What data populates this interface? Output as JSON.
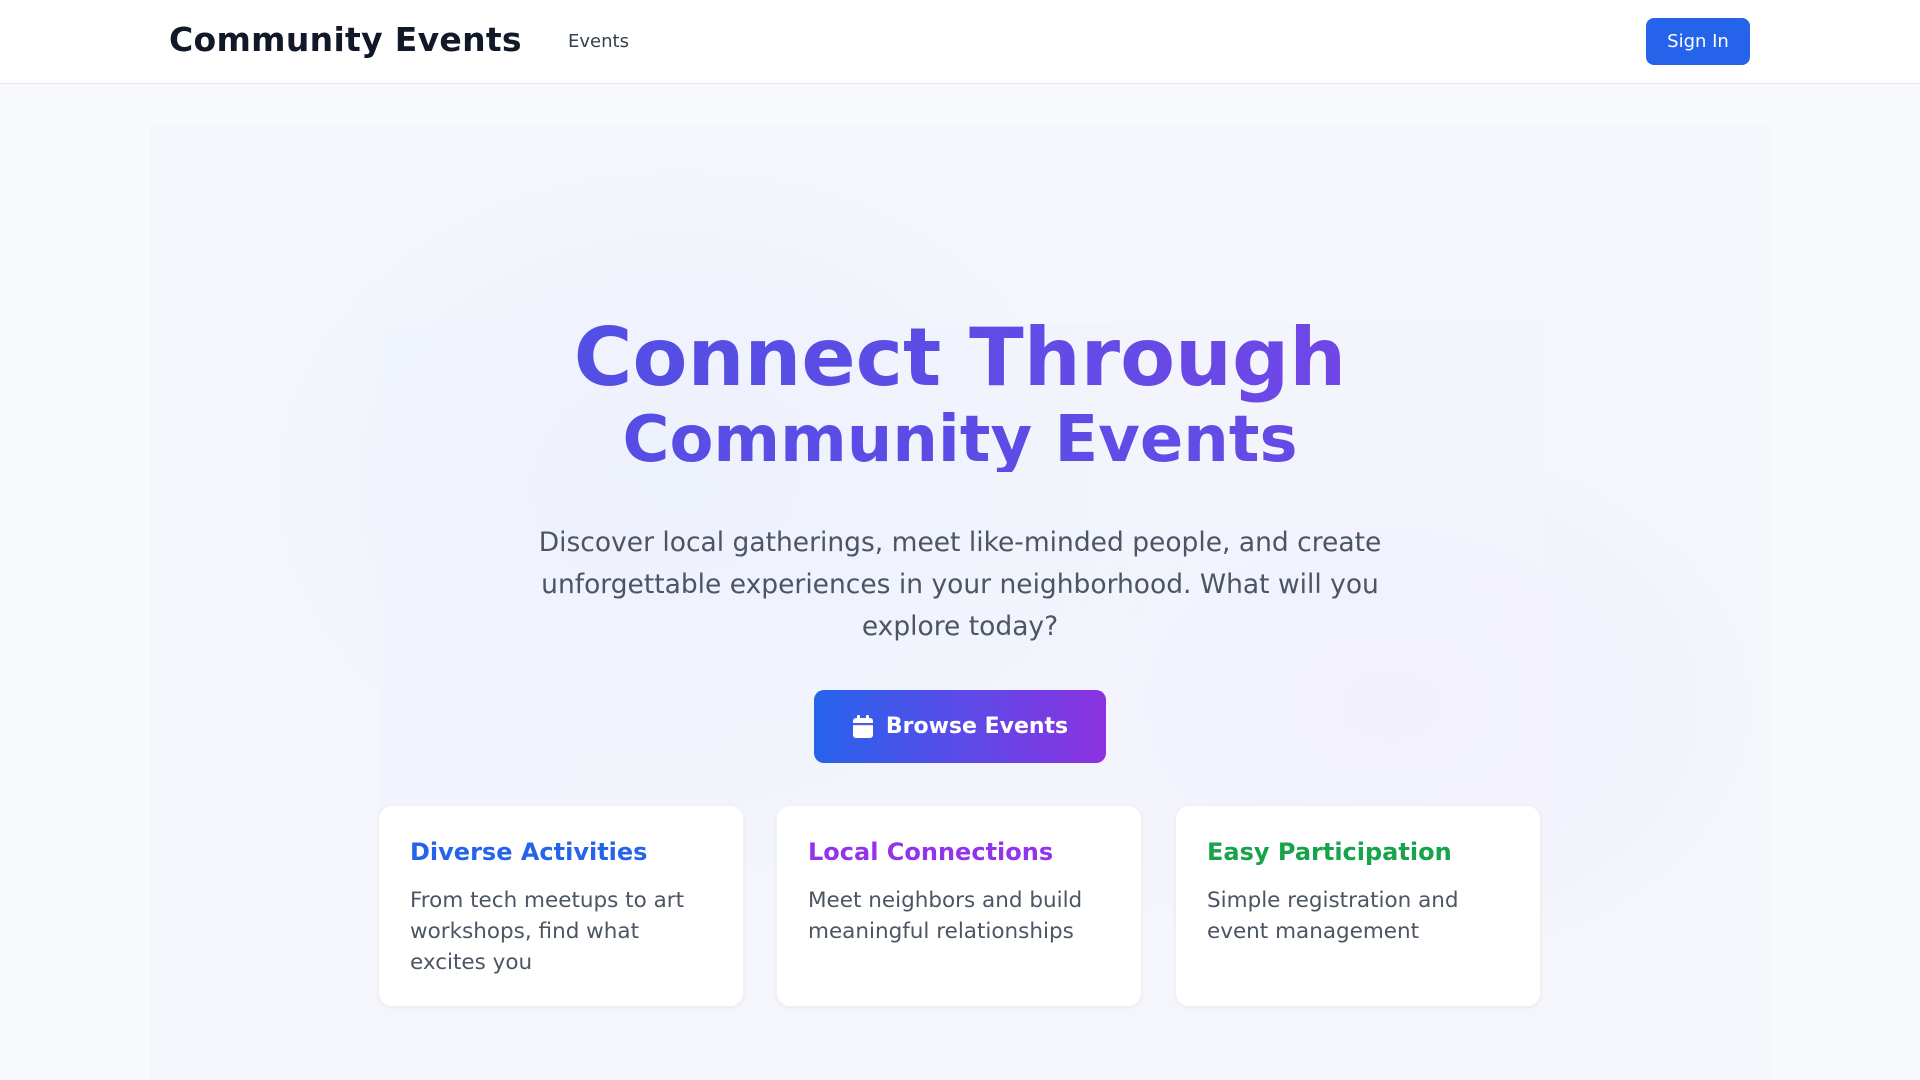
{
  "nav": {
    "brand": "Community Events",
    "links": [
      {
        "label": "Events"
      }
    ],
    "signin_label": "Sign In"
  },
  "hero": {
    "title_line1": "Connect Through",
    "title_line2": "Community Events",
    "subtitle": "Discover local gatherings, meet like-minded people, and create unforgettable experiences in your neighborhood. What will you explore today?",
    "cta_label": "Browse Events",
    "cta_icon": "calendar-icon"
  },
  "features": [
    {
      "title": "Diverse Activities",
      "text": "From tech meetups to art workshops, find what excites you",
      "color": "#2563eb"
    },
    {
      "title": "Local Connections",
      "text": "Meet neighbors and build meaningful relationships",
      "color": "#9333ea"
    },
    {
      "title": "Easy Participation",
      "text": "Simple registration and event management",
      "color": "#16a34a"
    }
  ],
  "colors": {
    "primary": "#2563eb",
    "accent_purple": "#9333ea",
    "accent_green": "#16a34a",
    "background": "#f8f9fc"
  }
}
